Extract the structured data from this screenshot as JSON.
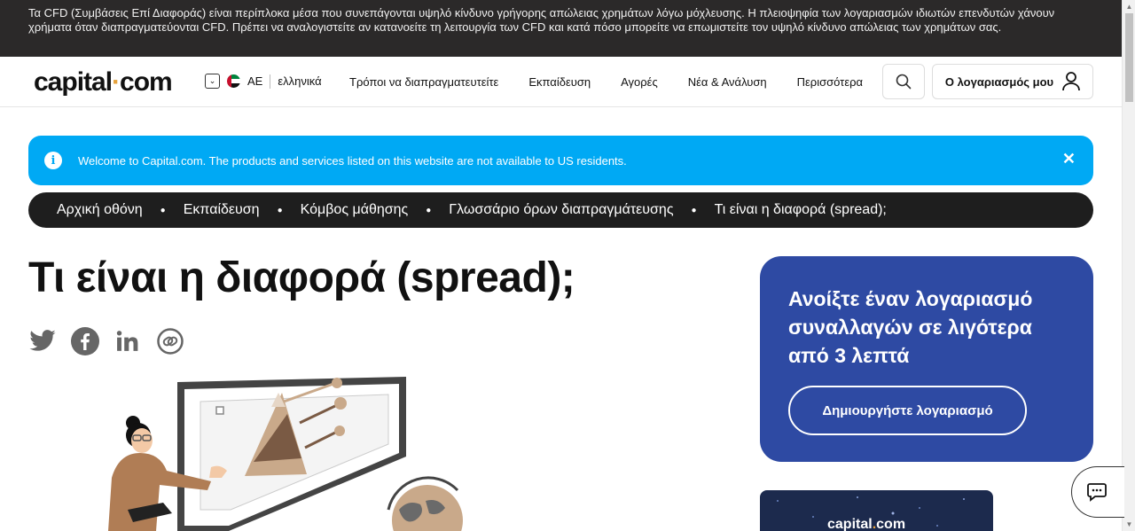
{
  "risk_warning": "Τα CFD (Συμβάσεις Επί Διαφοράς) είναι περίπλοκα μέσα που συνεπάγονται υψηλό κίνδυνο γρήγορης απώλειας χρημάτων λόγω μόχλευσης. Η πλειοψηφία των λογαριασμών ιδιωτών επενδυτών χάνουν χρήματα όταν διαπραγματεύονται CFD. Πρέπει να αναλογιστείτε αν κατανοείτε τη λειτουργία των CFD και κατά πόσο μπορείτε να επωμιστείτε τον υψηλό κίνδυνο απώλειας των χρημάτων σας.",
  "header": {
    "logo_left": "capital",
    "logo_dot": "·",
    "logo_right": "com",
    "region": "AE",
    "language": "ελληνικά",
    "nav": [
      "Τρόποι να διαπραγματευτείτε",
      "Εκπαίδευση",
      "Αγορές",
      "Νέα & Ανάλυση",
      "Περισσότερα"
    ],
    "account_label": "Ο λογαριασμός μου"
  },
  "notice": {
    "message": "Welcome to Capital.com. The products and services listed on this website are not available to US residents.",
    "close": "✕"
  },
  "breadcrumb": [
    "Αρχική οθόνη",
    "Εκπαίδευση",
    "Κόμβος μάθησης",
    "Γλωσσάριο όρων διαπραγμάτευσης",
    "Τι είναι η διαφορά (spread);"
  ],
  "page_title": "Τι είναι η διαφορά (spread);",
  "social_icons": [
    "twitter-icon",
    "facebook-icon",
    "linkedin-icon",
    "copy-link-icon"
  ],
  "cta": {
    "title": "Ανοίξτε έναν λογαριασμό συναλλαγών σε λιγότερα από 3 λεπτά",
    "button": "Δημιουργήστε λογαριασμό"
  },
  "promo": {
    "logo_left": "capital",
    "logo_dot": ".",
    "logo_right": "com"
  },
  "colors": {
    "risk_bg": "#2b2929",
    "notice_bg": "#00a9f4",
    "breadcrumb_bg": "#1e1e1e",
    "cta_bg": "#2e4aa3",
    "promo_bg": "#1c2a4d",
    "logo_accent": "#e6a23c"
  }
}
